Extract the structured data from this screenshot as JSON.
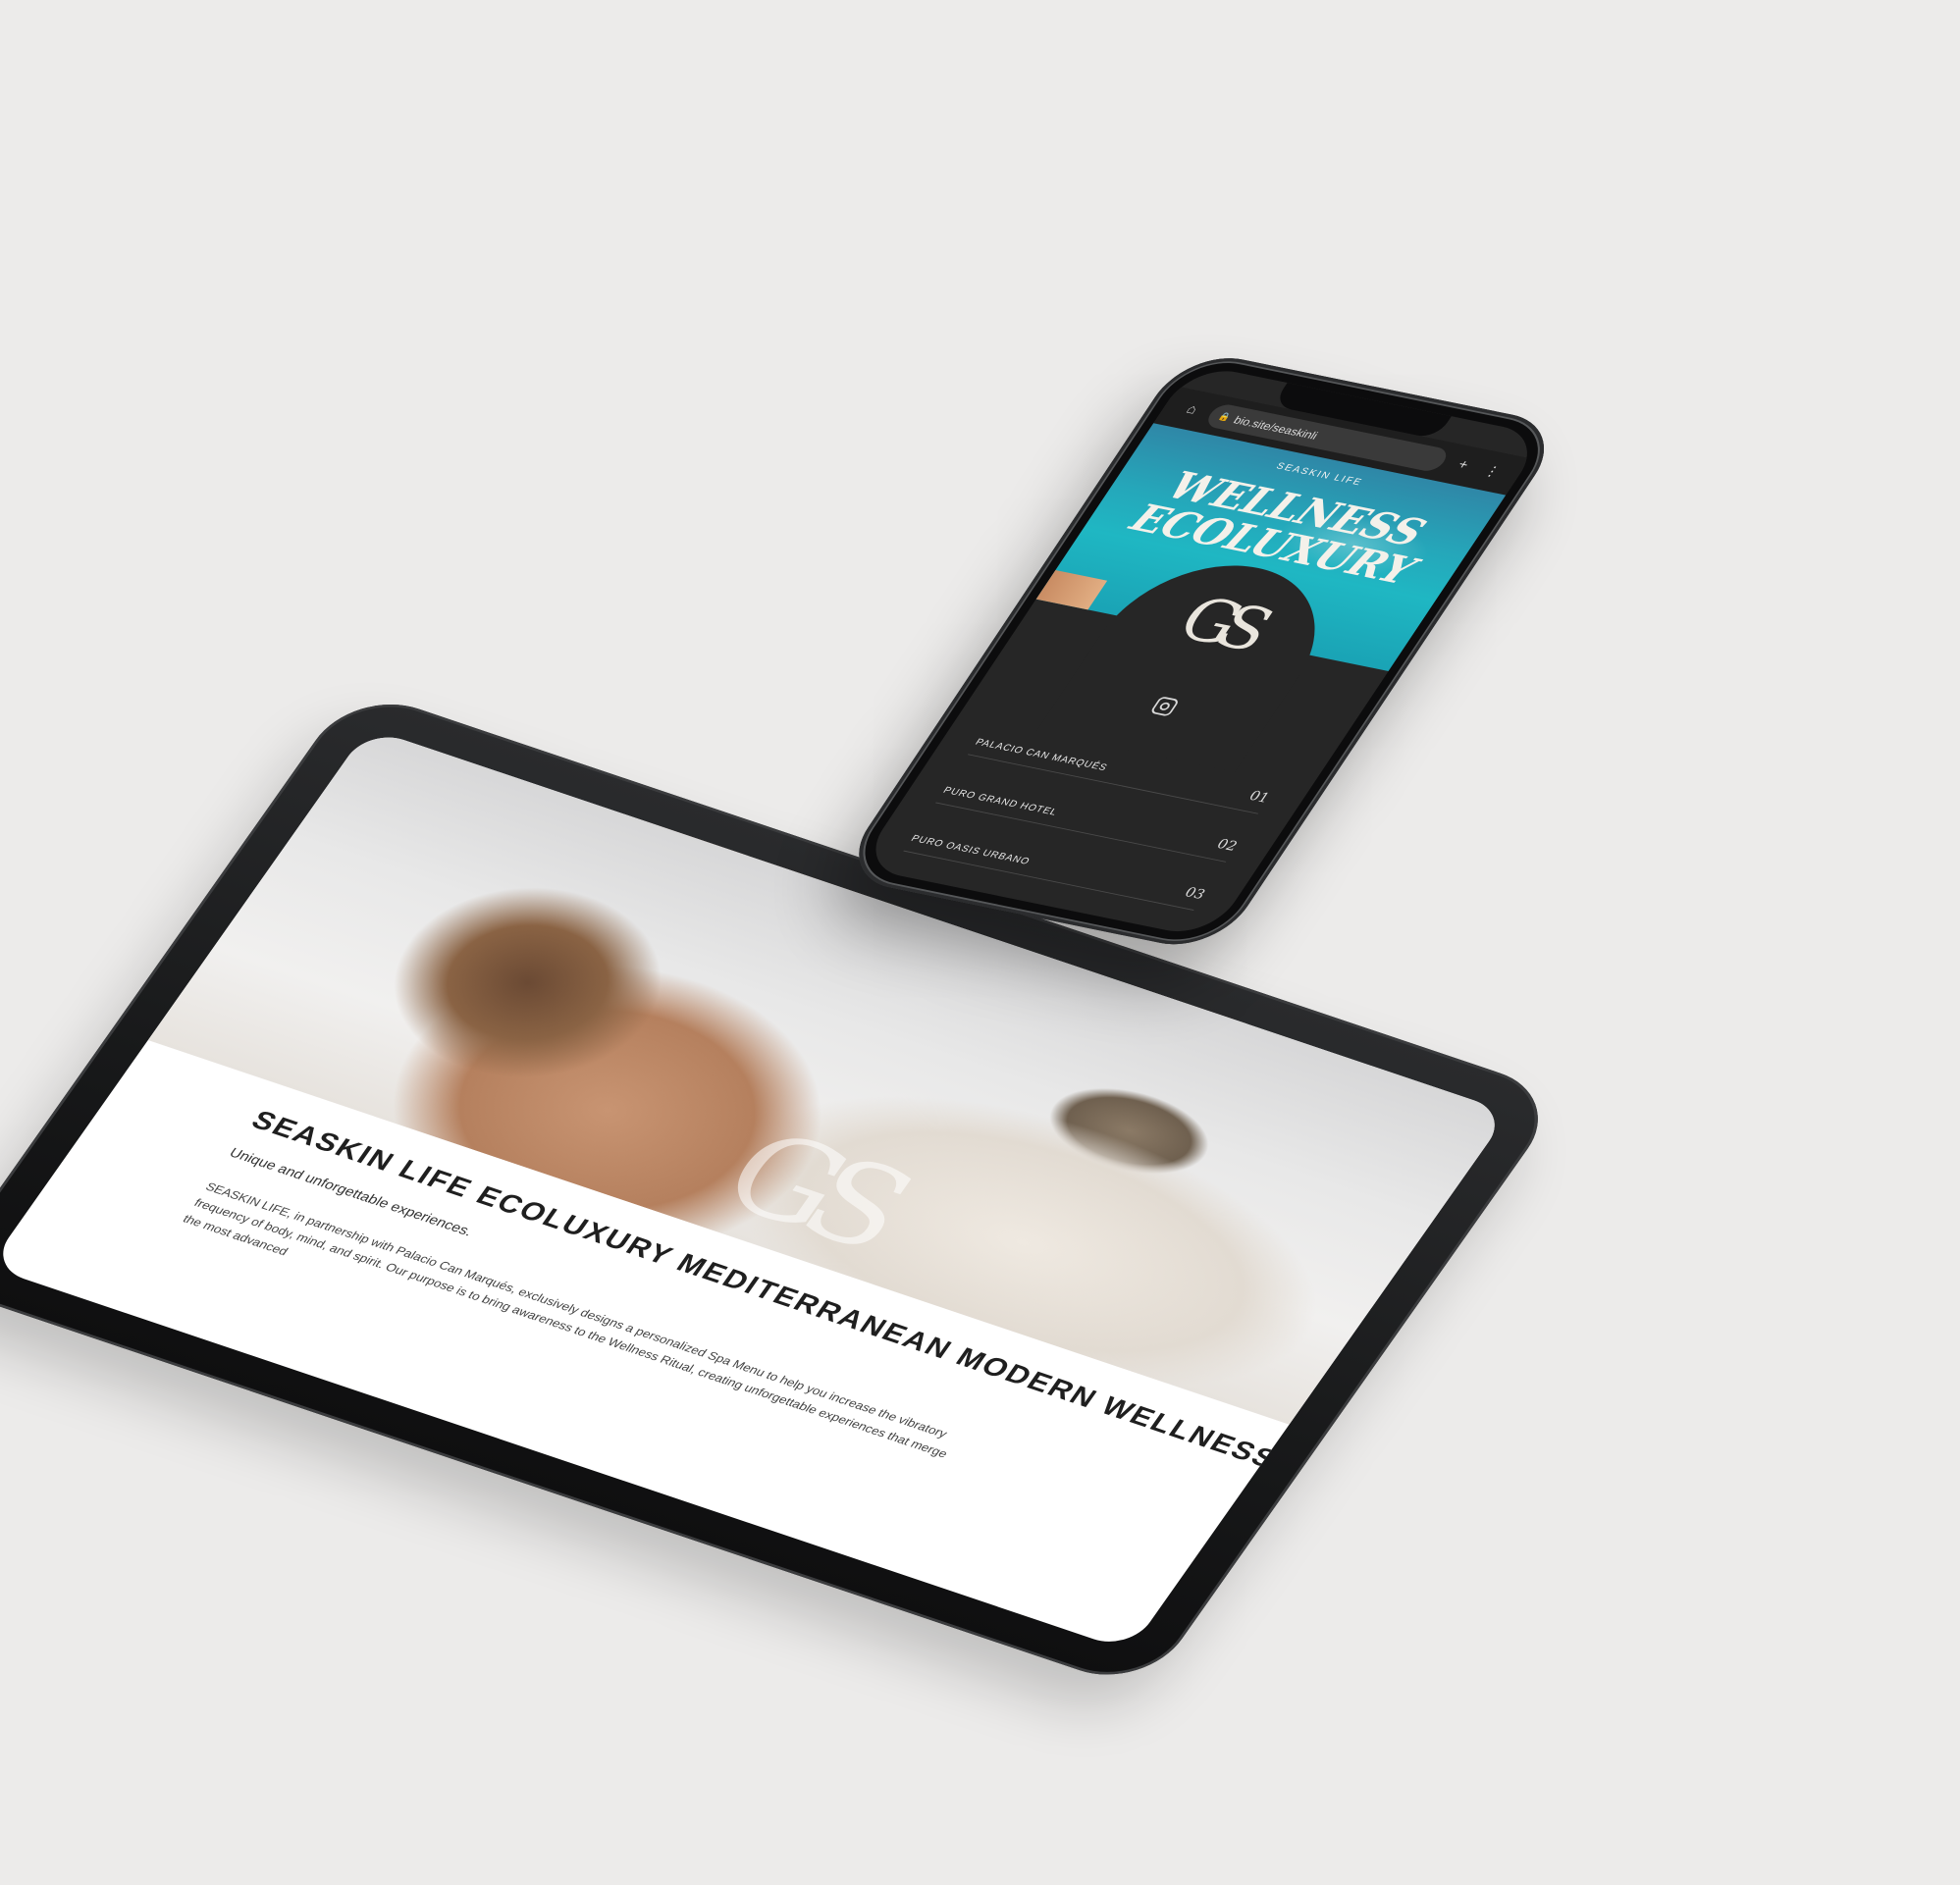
{
  "tablet": {
    "title": "SEASKIN LIFE ECOLUXURY MEDITERRANEAN MODERN WELLNESS",
    "subtitle": "Unique and unforgettable experiences.",
    "body": "SEASKIN LIFE, in partnership with Palacio Can Marqués, exclusively designs a personalized Spa Menu to help you increase the vibratory frequency of body, mind, and spirit. Our purpose is to bring awareness to the Wellness Ritual, creating unforgettable experiences that merge the most advanced",
    "hero_logo": "GS"
  },
  "phone": {
    "browser": {
      "url": "bio.site/seaskinli",
      "home_icon": "⌂",
      "lock_icon": "🔒",
      "new_tab_icon": "+",
      "menu_icon": "⋮"
    },
    "brand": "SEASKIN LIFE",
    "hero_title": "WELLNESS ECOLUXURY",
    "monogram": "GS",
    "links": [
      {
        "label": "PALACIO CAN MARQUÉS",
        "num": "01"
      },
      {
        "label": "PURO GRAND HOTEL",
        "num": "02"
      },
      {
        "label": "PURO OASIS URBANO",
        "num": "03"
      }
    ]
  },
  "colors": {
    "background": "#ecebea",
    "phone_dark": "#262626",
    "sea": "#1fb7c3"
  }
}
